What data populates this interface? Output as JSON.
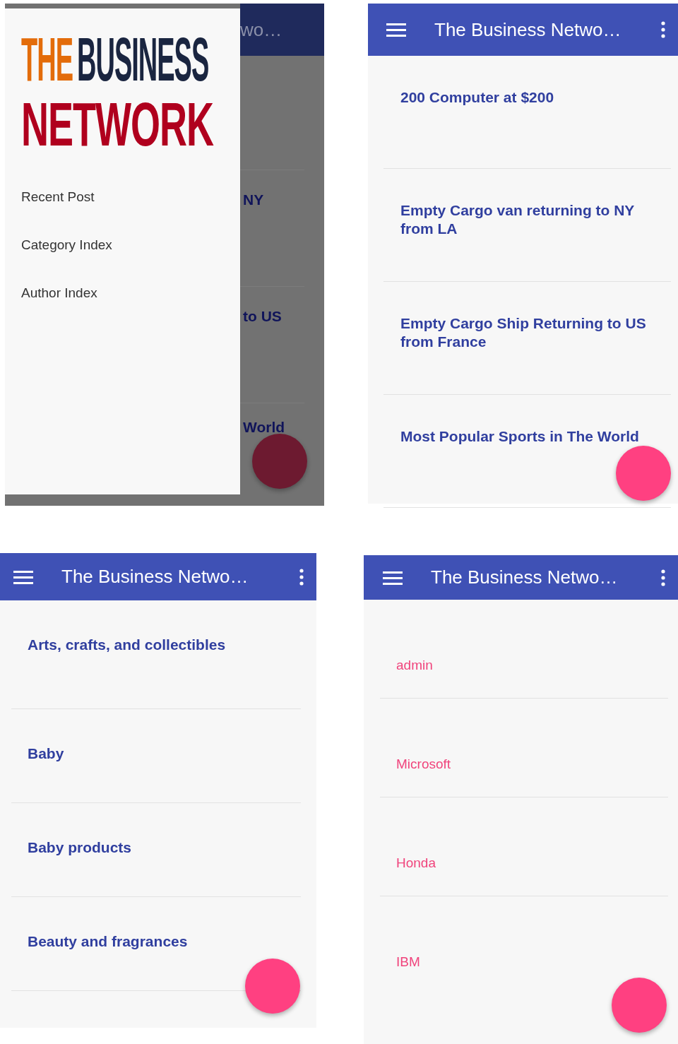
{
  "panels": [
    {
      "kind": "drawer",
      "app_bar": {
        "title": "wo…"
      },
      "background_items": [
        "NY",
        "to US",
        "World"
      ],
      "logo": [
        "THE",
        "BUSINESS",
        "NETWORK"
      ],
      "menu": [
        {
          "label": "Recent Post"
        },
        {
          "label": "Category Index"
        },
        {
          "label": "Author Index"
        }
      ]
    },
    {
      "kind": "posts",
      "app_bar": {
        "title": "The Business Netwo…"
      },
      "items": [
        "200 Computer at $200",
        "Empty Cargo van returning to NY from LA",
        "Empty Cargo Ship Returning to US from France",
        "Most Popular Sports in The World"
      ]
    },
    {
      "kind": "categories",
      "app_bar": {
        "title": "The Business Netwo…"
      },
      "items": [
        "Arts, crafts, and collectibles",
        "Baby",
        "Baby products",
        "Beauty and fragrances"
      ]
    },
    {
      "kind": "authors",
      "app_bar": {
        "title": "The Business Netwo…"
      },
      "items": [
        "admin",
        "Microsoft",
        "Honda",
        "IBM"
      ]
    }
  ]
}
